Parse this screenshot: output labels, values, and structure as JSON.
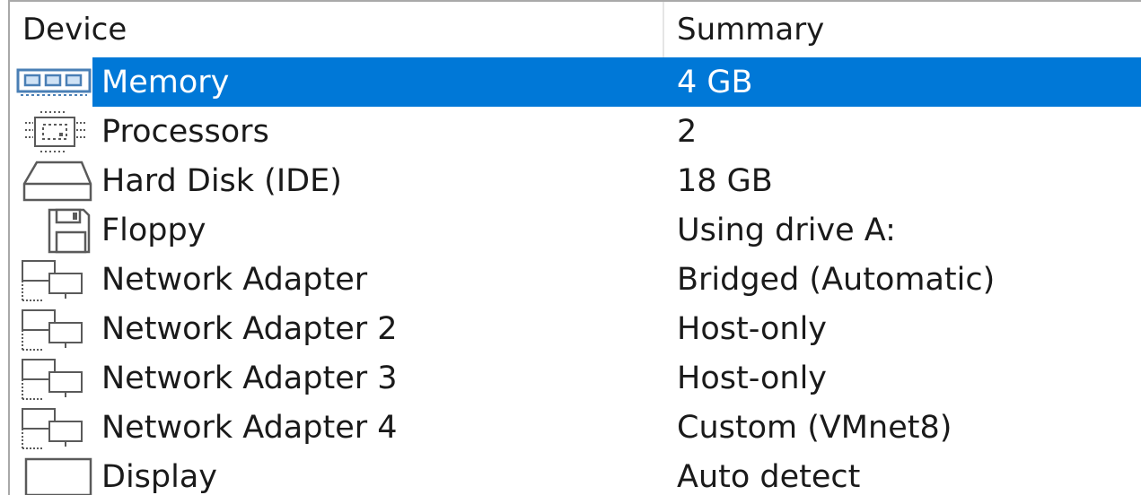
{
  "columns": {
    "device": "Device",
    "summary": "Summary"
  },
  "colors": {
    "selection": "#0078d7",
    "icon_stroke": "#5a5a5a"
  },
  "devices": [
    {
      "name": "Memory",
      "summary": "4 GB",
      "icon": "memory-icon",
      "selected": true
    },
    {
      "name": "Processors",
      "summary": "2",
      "icon": "processor-icon",
      "selected": false
    },
    {
      "name": "Hard Disk (IDE)",
      "summary": "18 GB",
      "icon": "hard-disk-icon",
      "selected": false
    },
    {
      "name": "Floppy",
      "summary": "Using drive A:",
      "icon": "floppy-icon",
      "selected": false
    },
    {
      "name": "Network Adapter",
      "summary": "Bridged (Automatic)",
      "icon": "network-adapter-icon",
      "selected": false
    },
    {
      "name": "Network Adapter 2",
      "summary": "Host-only",
      "icon": "network-adapter-icon",
      "selected": false
    },
    {
      "name": "Network Adapter 3",
      "summary": "Host-only",
      "icon": "network-adapter-icon",
      "selected": false
    },
    {
      "name": "Network Adapter 4",
      "summary": "Custom (VMnet8)",
      "icon": "network-adapter-icon",
      "selected": false
    },
    {
      "name": "Display",
      "summary": "Auto detect",
      "icon": "display-icon",
      "selected": false
    }
  ]
}
